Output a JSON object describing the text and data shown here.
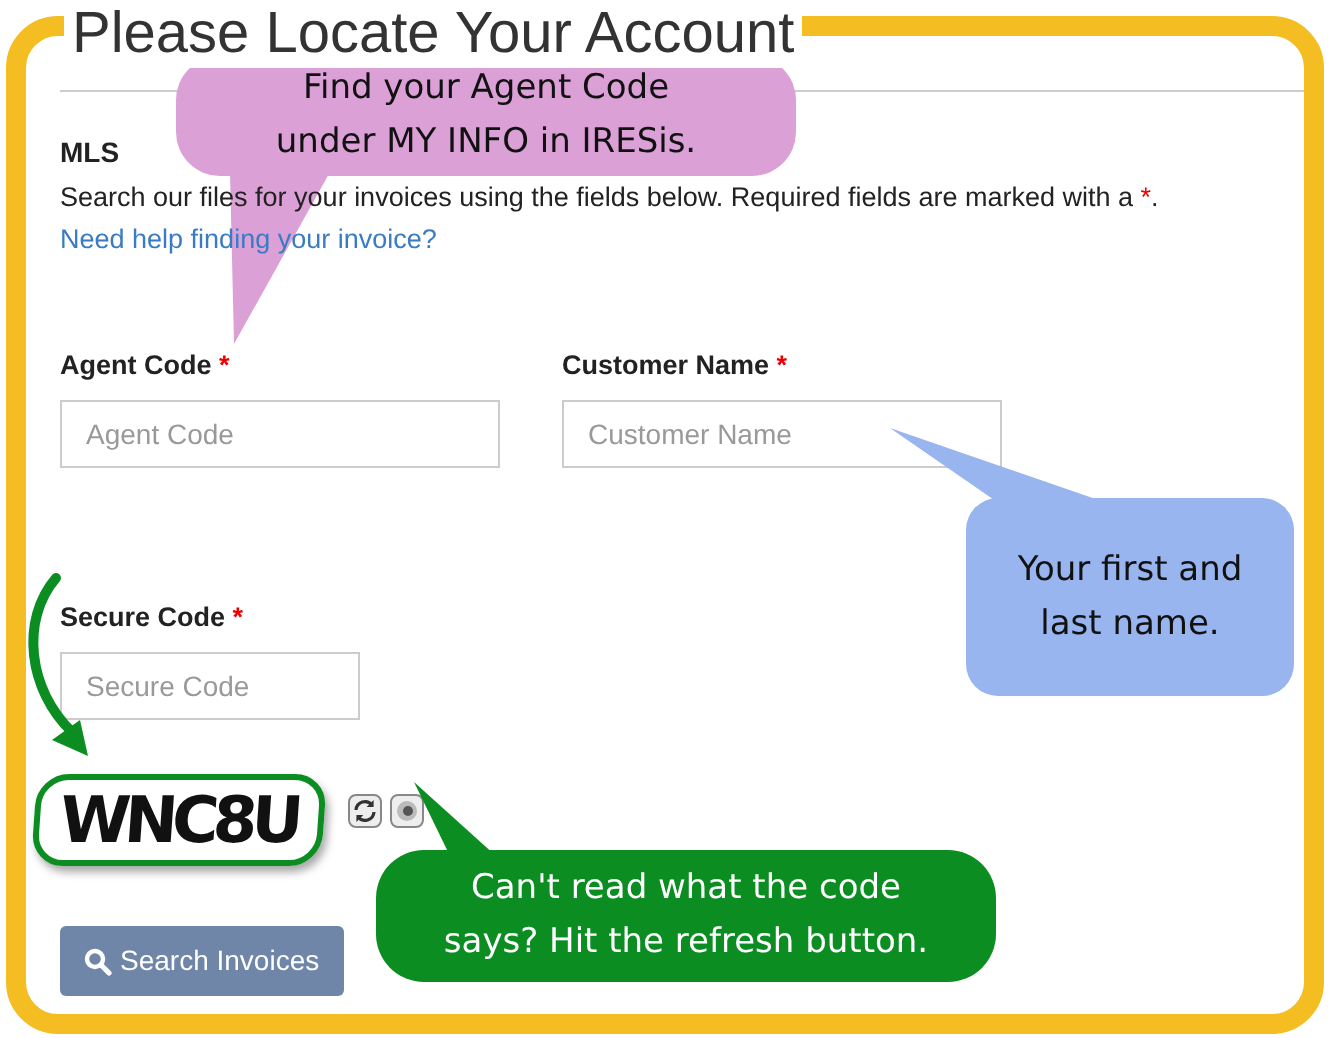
{
  "page": {
    "title": "Please Locate Your Account"
  },
  "section": {
    "heading": "MLS",
    "description_before": "Search our files for your invoices using the fields below.  Required fields are marked with a ",
    "description_mark": "*",
    "description_after": ".",
    "help_link": "Need help finding your invoice?"
  },
  "fields": [
    {
      "label": "Agent Code",
      "required": true,
      "placeholder": "Agent Code"
    },
    {
      "label": "Customer Name",
      "required": true,
      "placeholder": "Customer Name"
    },
    {
      "label": "Secure Code",
      "required": true,
      "placeholder": "Secure Code"
    }
  ],
  "required_mark": "*",
  "captcha": {
    "text": "WNC8U"
  },
  "search_button": {
    "label": "Search Invoices"
  },
  "callouts": [
    {
      "text": "Find your Agent Code under MY INFO in IRESis.",
      "color": "#dba0d6"
    },
    {
      "text": "Your first and last name.",
      "color": "#98b5ef"
    },
    {
      "text": "Can't read what the code says?  Hit the refresh button.",
      "color": "#0b8d22"
    }
  ]
}
